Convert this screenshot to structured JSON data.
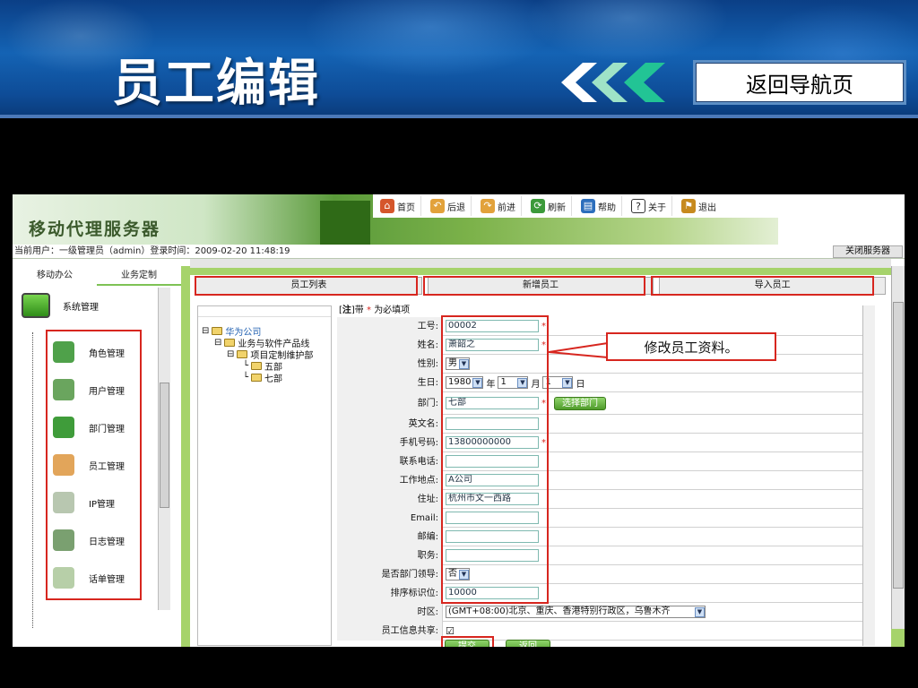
{
  "slide": {
    "title": "员工编辑",
    "back_label": "返回导航页"
  },
  "app": {
    "logo": "移动代理服务器",
    "toolbar": [
      {
        "label": "首页",
        "icon": "home-icon"
      },
      {
        "label": "后退",
        "icon": "back-arrow-icon"
      },
      {
        "label": "前进",
        "icon": "forward-arrow-icon"
      },
      {
        "label": "刷新",
        "icon": "refresh-icon"
      },
      {
        "label": "帮助",
        "icon": "help-book-icon"
      },
      {
        "label": "关于",
        "icon": "question-icon"
      },
      {
        "label": "退出",
        "icon": "exit-person-icon"
      }
    ],
    "status_line": "当前用户：一级管理员（admin）登录时间：2009-02-20 11:48:19",
    "close_server": "关闭服务器"
  },
  "left_panel": {
    "tabs": [
      "移动办公",
      "业务定制"
    ],
    "system": "系统管理",
    "items": [
      "角色管理",
      "用户管理",
      "部门管理",
      "员工管理",
      "IP管理",
      "日志管理",
      "话单管理"
    ]
  },
  "tabs": [
    "员工列表",
    "新增员工",
    "导入员工"
  ],
  "tree": {
    "root": "华为公司",
    "child": "业务与软件产品线",
    "grandchild": "项目定制维护部",
    "leaf1": "五部",
    "leaf2": "七部"
  },
  "form": {
    "note_prefix": "[",
    "note_bold": "注",
    "note_mid": "]带",
    "note_star": "*",
    "note_suffix": "为必填项",
    "fields": {
      "emp_no": {
        "label": "工号:",
        "value": "00002"
      },
      "name": {
        "label": "姓名:",
        "value": "萧韶之"
      },
      "gender": {
        "label": "性别:",
        "value": "男"
      },
      "birth": {
        "label": "生日:",
        "year": "1980",
        "year_unit": "年",
        "month": "1",
        "month_unit": "月",
        "day": "1",
        "day_unit": "日"
      },
      "dept": {
        "label": "部门:",
        "value": "七部",
        "btn": "选择部门"
      },
      "en_name": {
        "label": "英文名:",
        "value": ""
      },
      "mobile": {
        "label": "手机号码:",
        "value": "13800000000"
      },
      "phone": {
        "label": "联系电话:",
        "value": ""
      },
      "workplace": {
        "label": "工作地点:",
        "value": "A公司"
      },
      "address": {
        "label": "住址:",
        "value": "杭州市文一西路"
      },
      "email": {
        "label": "Email:",
        "value": ""
      },
      "zip": {
        "label": "邮编:",
        "value": ""
      },
      "position": {
        "label": "职务:",
        "value": ""
      },
      "leader": {
        "label": "是否部门领导:",
        "value": "否"
      },
      "sort": {
        "label": "排序标识位:",
        "value": "10000"
      },
      "timezone": {
        "label": "时区:",
        "value": "(GMT+08:00)北京、重庆、香港特别行政区，乌鲁木齐"
      },
      "share": {
        "label": "员工信息共享:",
        "value": "☑"
      }
    },
    "submit": "提交",
    "back": "返回"
  },
  "callout": "修改员工资料。",
  "colors": {
    "accent_red": "#d7261f",
    "frame_green": "#a6d36b",
    "banner_blue": "#1463b4"
  }
}
